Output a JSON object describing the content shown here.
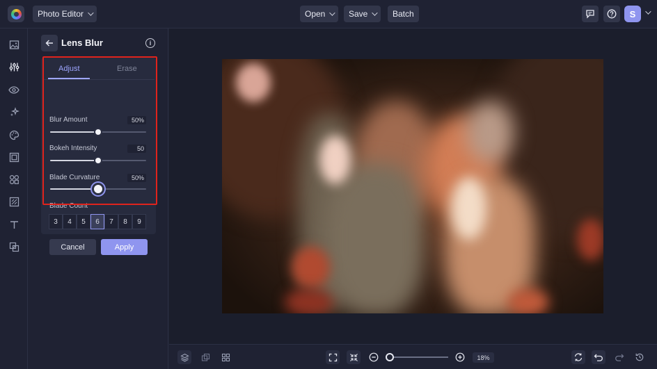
{
  "topbar": {
    "app_menu_label": "Photo Editor",
    "open_label": "Open",
    "save_label": "Save",
    "batch_label": "Batch",
    "avatar_initial": "S"
  },
  "panel": {
    "title": "Lens Blur",
    "tabs": [
      {
        "label": "Adjust",
        "active": true
      },
      {
        "label": "Erase",
        "active": false
      }
    ],
    "controls": {
      "blur_amount": {
        "label": "Blur Amount",
        "value": "50%",
        "level": 0.5
      },
      "bokeh_intensity": {
        "label": "Bokeh Intensity",
        "value": "50",
        "level": 0.5
      },
      "blade_curvature": {
        "label": "Blade Curvature",
        "value": "50%",
        "level": 0.5
      }
    },
    "blade_count": {
      "label": "Blade Count",
      "options": [
        "3",
        "4",
        "5",
        "6",
        "7",
        "8",
        "9"
      ],
      "selected": "6"
    },
    "cancel_label": "Cancel",
    "apply_label": "Apply"
  },
  "bottombar": {
    "zoom_value": "18%",
    "zoom_level": 0.02
  },
  "colors": {
    "accent": "#8f95ef",
    "highlight_border": "#e0231c",
    "apply_button": "#8f95ef",
    "background": "#1f2233"
  },
  "icons": {
    "rail": [
      "image-icon",
      "sliders-icon",
      "eye-icon",
      "sparkles-icon",
      "palette-icon",
      "frame-icon",
      "shapes-icon",
      "texture-icon",
      "text-icon",
      "overlay-icon"
    ],
    "topbar": [
      "comment-icon",
      "help-icon",
      "chevron-down-icon"
    ],
    "bottombar": [
      "layers-icon",
      "copy-icon",
      "grid-icon",
      "fit-screen-icon",
      "shrink-icon",
      "zoom-out-icon",
      "zoom-in-icon",
      "rotate-icon",
      "undo-icon",
      "redo-icon",
      "history-icon"
    ]
  }
}
